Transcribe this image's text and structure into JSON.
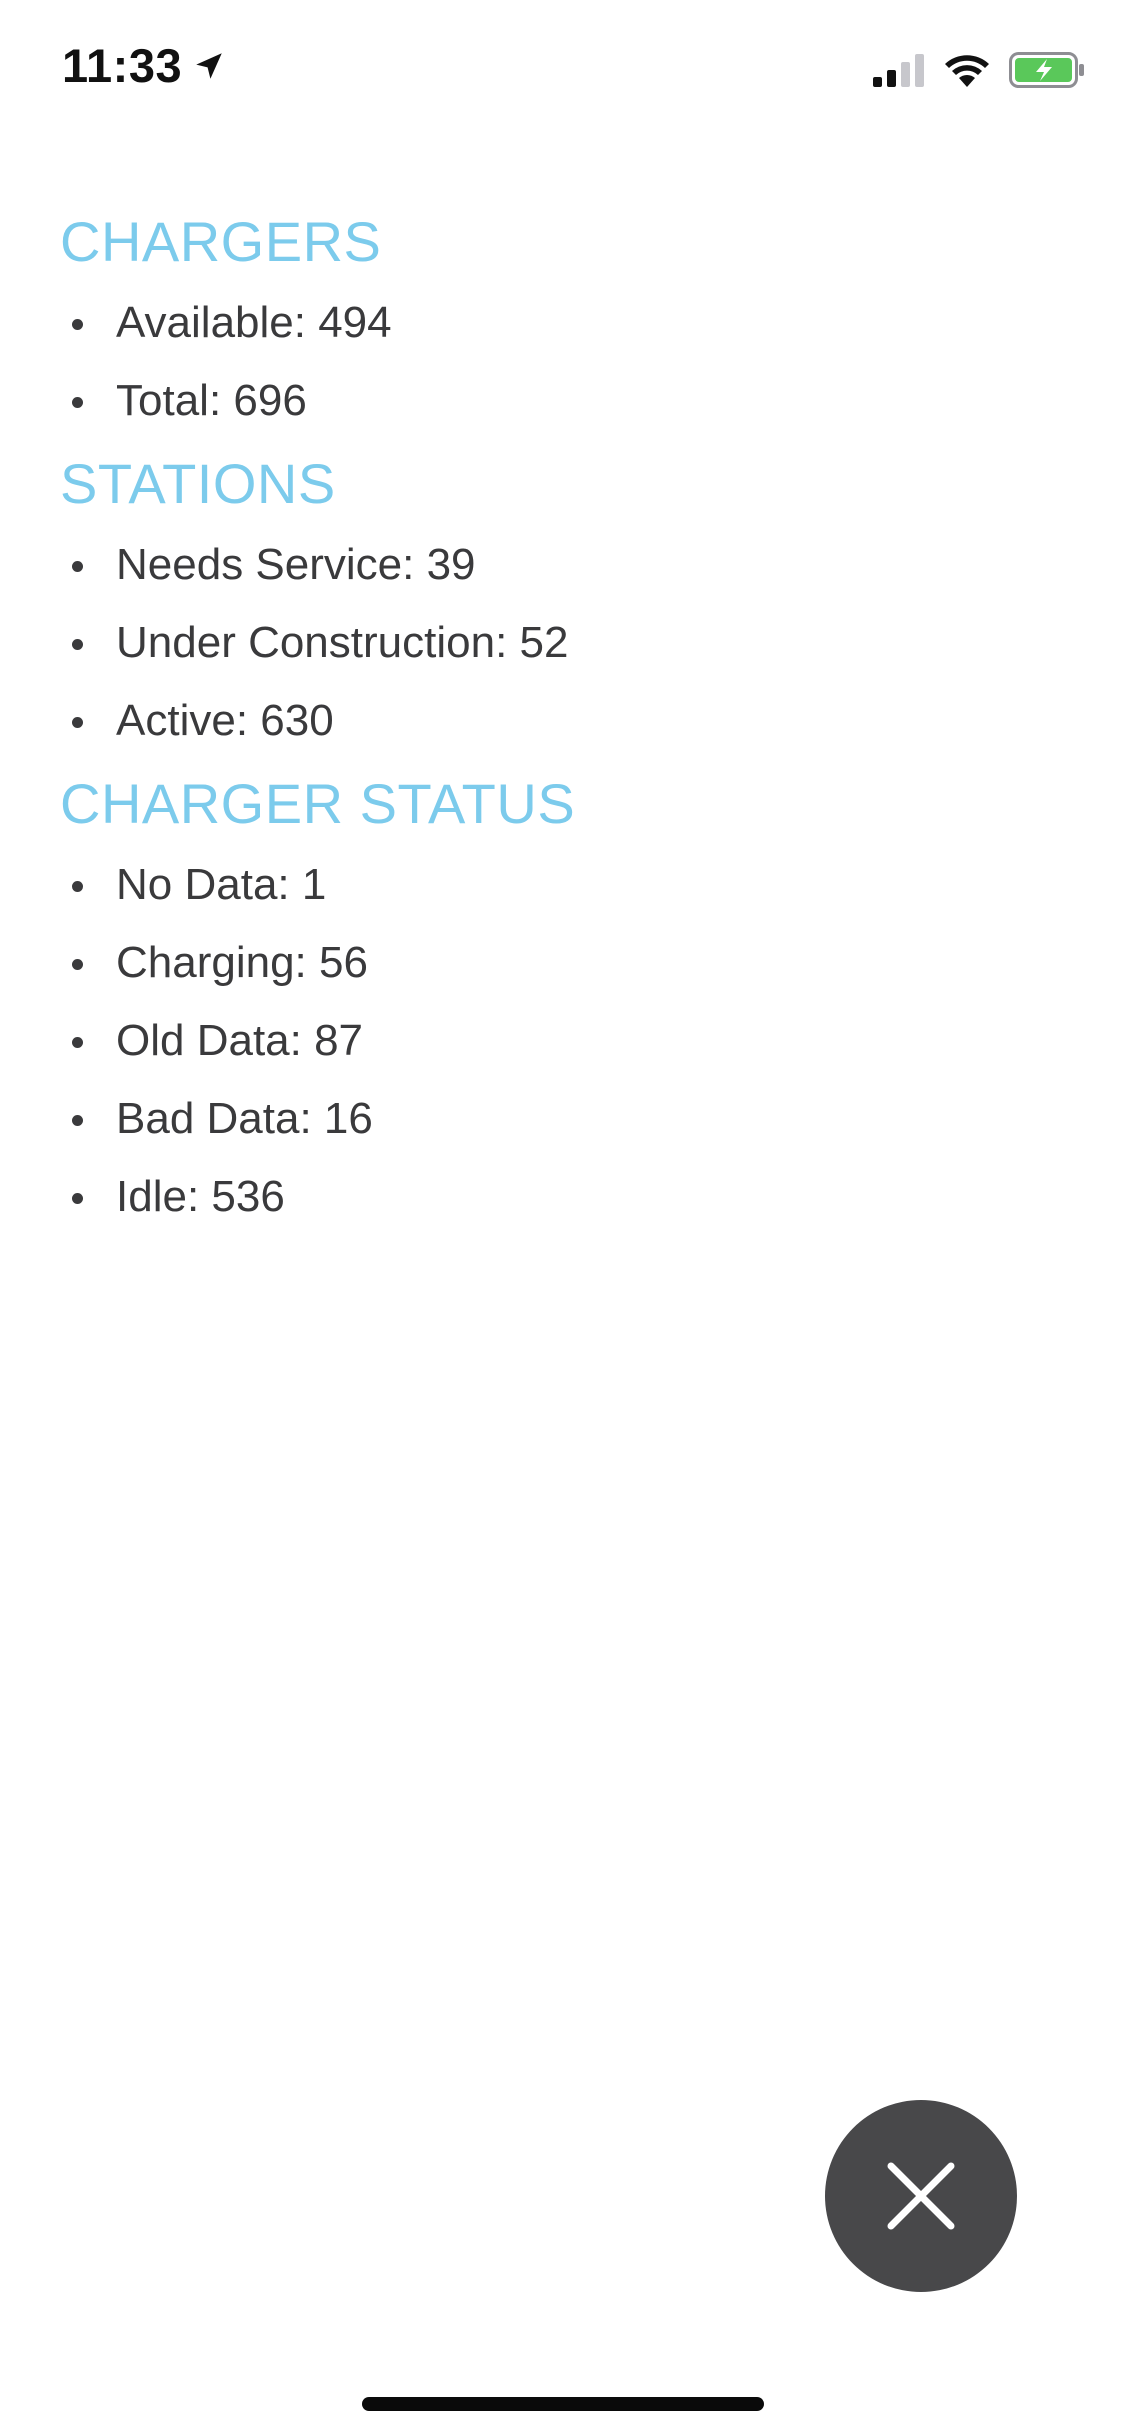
{
  "status_bar": {
    "time": "11:33",
    "icons": [
      "location-arrow-icon",
      "cellular-signal-icon",
      "wifi-icon",
      "battery-charging-icon"
    ],
    "battery_color": "#5ac85a"
  },
  "sections": [
    {
      "title": "CHARGERS",
      "items": [
        "Available: 494",
        "Total: 696"
      ]
    },
    {
      "title": "STATIONS",
      "items": [
        "Needs Service: 39",
        "Under Construction: 52",
        "Active: 630"
      ]
    },
    {
      "title": "CHARGER STATUS",
      "items": [
        "No Data: 1",
        "Charging: 56",
        "Old Data: 87",
        "Bad Data: 16",
        "Idle: 536"
      ]
    }
  ],
  "close_button": {
    "icon": "close-icon"
  },
  "colors": {
    "section_title": "#7ccbec",
    "text": "#3a3a3c",
    "fab": "#48484a"
  }
}
